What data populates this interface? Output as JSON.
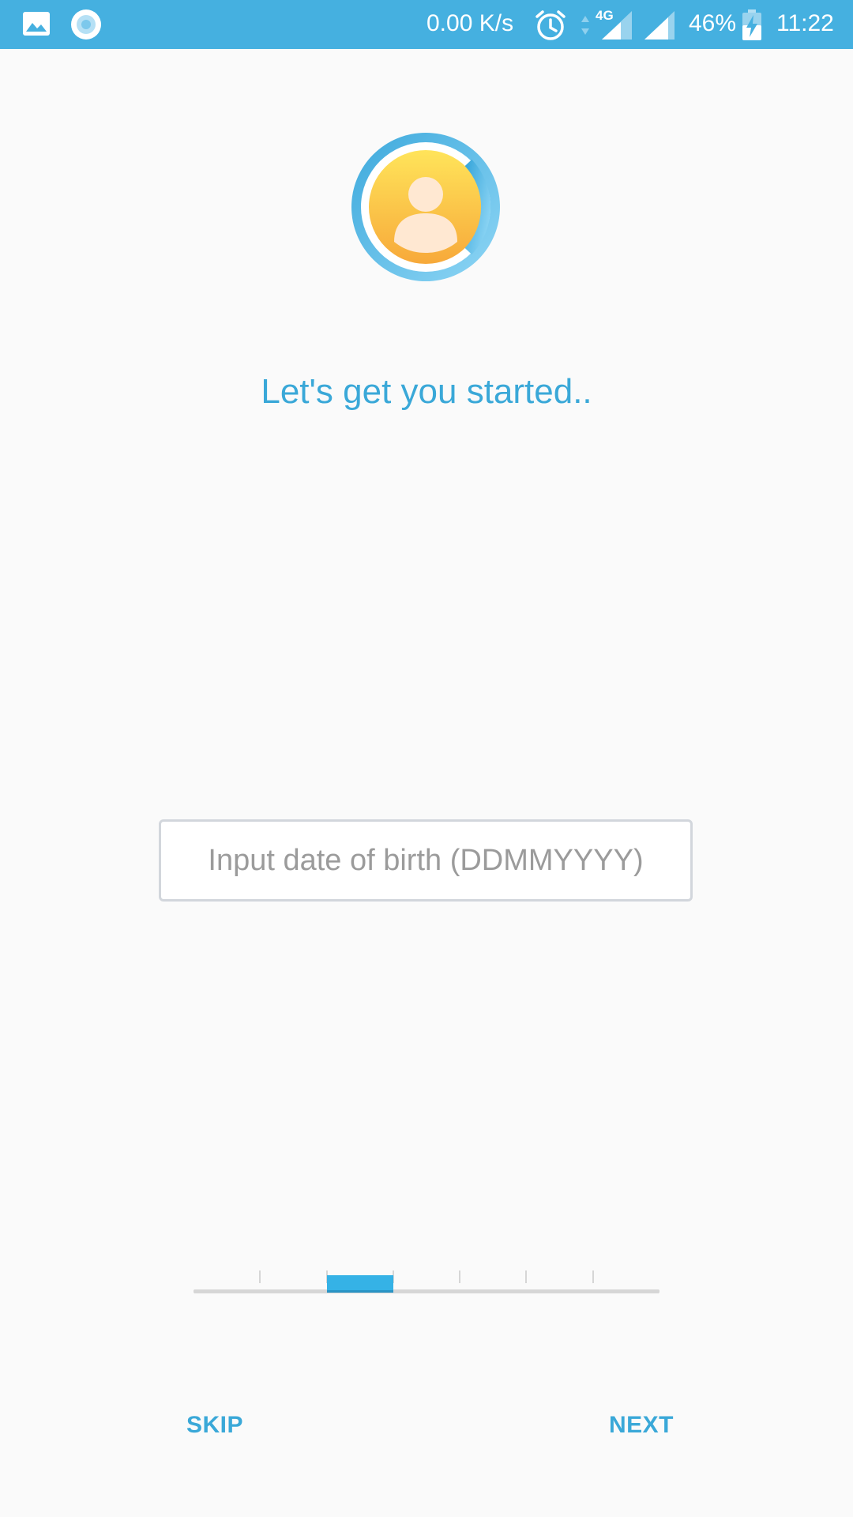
{
  "status_bar": {
    "network_speed": "0.00 K/s",
    "network_type": "4G",
    "battery": "46%",
    "time": "11:22",
    "icons": [
      "gallery-icon",
      "app-notification-icon",
      "alarm-icon",
      "data-arrows-icon",
      "signal-4g-icon",
      "signal-icon",
      "battery-charging-icon"
    ],
    "background_color": "#45b0e0"
  },
  "header": {
    "avatar_icon": "user-avatar-icon",
    "title": "Let's get you started.."
  },
  "form": {
    "dob_placeholder": "Input date of birth (DDMMYYYY)",
    "dob_value": ""
  },
  "progress": {
    "total_steps": 7,
    "current_step": 3
  },
  "footer": {
    "skip_label": "SKIP",
    "next_label": "NEXT"
  },
  "colors": {
    "accent": "#3aa8d8",
    "progress_active": "#35b2e6",
    "background": "#fafafa"
  }
}
